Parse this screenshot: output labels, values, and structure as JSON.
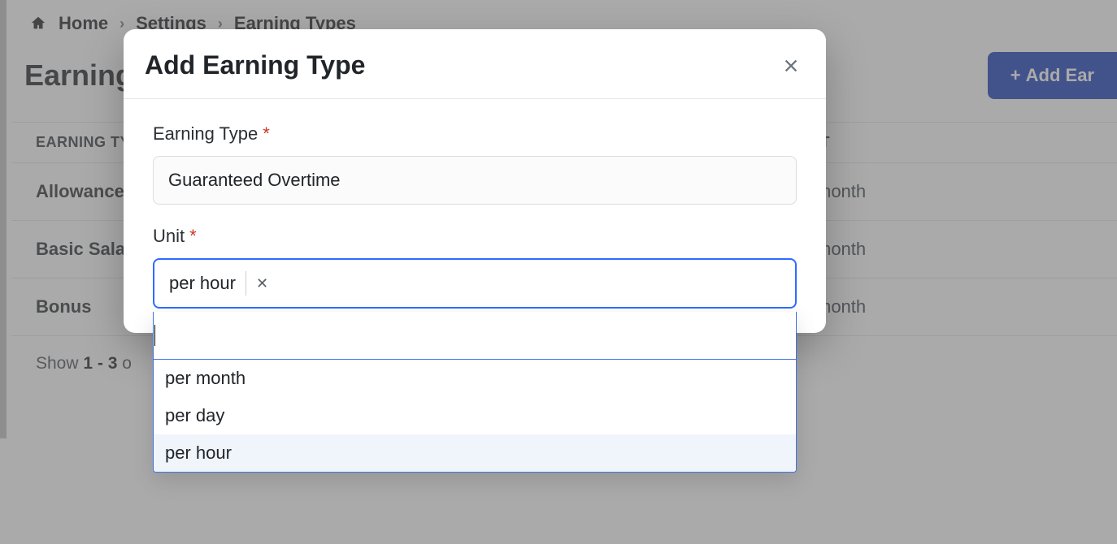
{
  "breadcrumb": {
    "home": "Home",
    "settings": "Settings",
    "current": "Earning Types"
  },
  "header": {
    "title": "Earning",
    "add_button": "Add Ear",
    "add_button_plus": "+"
  },
  "table": {
    "col_type": "Earning Ty",
    "col_unit": "it",
    "rows": [
      {
        "type": "Allowance",
        "unit": "month"
      },
      {
        "type": "Basic Salary",
        "unit": "month"
      },
      {
        "type": "Bonus",
        "unit": "month"
      }
    ],
    "pager_prefix": "Show ",
    "pager_range": "1 - 3",
    "pager_suffix": " o"
  },
  "modal": {
    "title": "Add Earning Type",
    "field_type_label": "Earning Type",
    "field_type_value": "Guaranteed Overtime",
    "field_unit_label": "Unit",
    "unit_selected": "per hour",
    "unit_search_value": "",
    "unit_options": [
      "per month",
      "per day",
      "per hour"
    ],
    "required_mark": "*"
  }
}
